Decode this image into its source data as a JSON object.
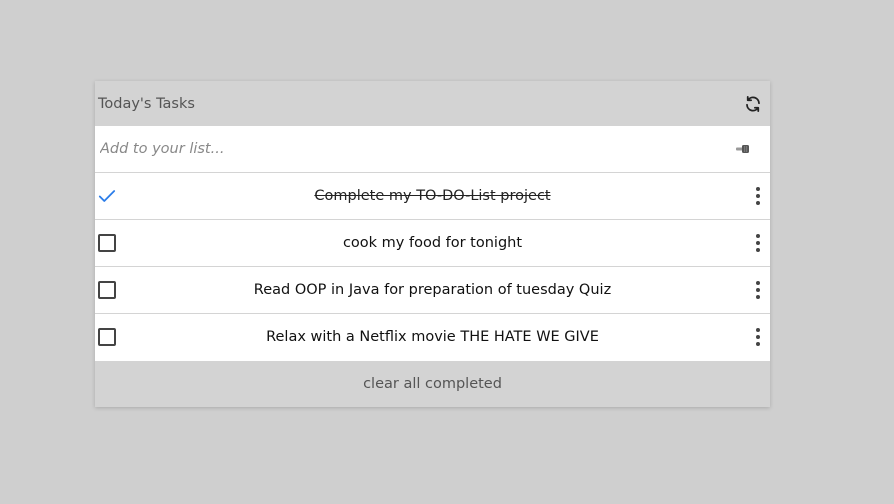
{
  "header": {
    "title": "Today's Tasks",
    "refresh_icon": "refresh-icon"
  },
  "add": {
    "placeholder": "Add to your list...",
    "submit_icon": "pointing-hand-icon"
  },
  "tasks": [
    {
      "text": "Complete my TO-DO-List project",
      "completed": true
    },
    {
      "text": "cook my food for tonight",
      "completed": false
    },
    {
      "text": "Read OOP in Java for preparation of tuesday Quiz",
      "completed": false
    },
    {
      "text": "Relax with a Netflix movie THE HATE WE GIVE",
      "completed": false
    }
  ],
  "footer": {
    "clear_label": "clear all completed"
  },
  "colors": {
    "background": "#cfcfcf",
    "header_bg": "#d3d3d3",
    "checkmark": "#2b7de9",
    "text": "#111111"
  }
}
